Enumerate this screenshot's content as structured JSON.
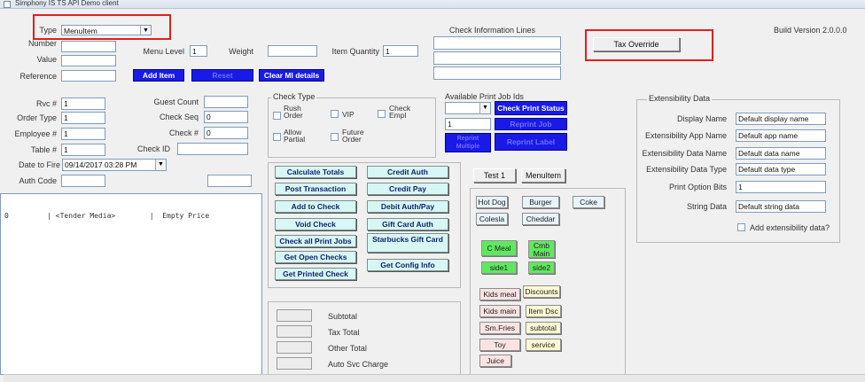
{
  "window": {
    "title": "Simphony IS TS API Demo client"
  },
  "build_version": "Build Version 2.0.0.0",
  "top": {
    "type_label": "Type",
    "type_value": "MenuItem",
    "number_label": "Number",
    "value_label": "Value",
    "reference_label": "Reference",
    "menu_level_label": "Menu Level",
    "menu_level_value": "1",
    "weight_label": "Weight",
    "item_quantity_label": "Item Quantity",
    "item_quantity_value": "1",
    "add_item": "Add Item",
    "reset": "Reset",
    "clear_mi_details": "Clear MI details",
    "check_info_lines_label": "Check Information Lines",
    "tax_override": "Tax Override"
  },
  "left": {
    "rvc_label": "Rvc #",
    "rvc_value": "1",
    "order_type_label": "Order Type",
    "order_type_value": "1",
    "employee_label": "Employee #",
    "employee_value": "1",
    "table_label": "Table #",
    "table_value": "1",
    "date_label": "Date to Fire",
    "date_value": "09/14/2017  03:28 PM",
    "auth_code_label": "Auth Code",
    "guest_count_label": "Guest Count",
    "check_seq_label": "Check Seq",
    "check_seq_value": "0",
    "check_num_label": "Check #",
    "check_num_value": "0",
    "check_id_label": "Check ID",
    "list_row": "0         | <Tender Media>        |  Empty Price"
  },
  "check_type": {
    "title": "Check Type",
    "rush_order": "Rush Order",
    "vip": "VIP",
    "check_empl": "Check Empl",
    "allow_partial": "Allow Partial",
    "future_order": "Future Order"
  },
  "print_jobs": {
    "title": "Available Print Job Ids",
    "input_value": "1",
    "check_print_status": "Check Print Status",
    "reprint_job": "Reprint Job",
    "reprint_label": "Reprint Label",
    "reprint_multiple": "Reprint Multiple"
  },
  "actions": {
    "calculate_totals": "Calculate Totals",
    "post_transaction": "Post Transaction",
    "add_to_check": "Add to Check",
    "void_check": "Void Check",
    "check_all_print_jobs": "Check all Print Jobs",
    "get_open_checks": "Get Open Checks",
    "get_printed_check": "Get Printed Check",
    "credit_auth": "Credit Auth",
    "credit_pay": "Credit Pay",
    "debit_auth_pay": "Debit Auth/Pay",
    "gift_card_auth": "Gift Card Auth",
    "starbucks_gift_card": "Starbucks Gift Card",
    "get_config_info": "Get Config Info"
  },
  "totals": {
    "subtotal": "Subtotal",
    "tax_total": "Tax Total",
    "other_total": "Other Total",
    "auto_svc_charge": "Auto Svc Charge"
  },
  "product_tabs": {
    "test1": "Test 1",
    "menuitem": "MenuItem"
  },
  "products": {
    "hot_dog": "Hot Dog",
    "burger": "Burger",
    "coke": "Coke",
    "coleslaw": "Colesla",
    "cheddar": "Cheddar",
    "c_meal": "C Meal",
    "cmb_main": "Cmb Main",
    "side1": "side1",
    "side2": "side2",
    "kids_meal": "Kids meal",
    "discounts": "Discounts",
    "kids_main": "Kids main",
    "item_disc": "Item Dsc",
    "sm_fries": "Sm.Fries",
    "subtotal": "subtotal",
    "toy": "Toy",
    "service": "service",
    "juice": "Juice"
  },
  "ext": {
    "title": "Extensibility Data",
    "display_name_label": "Display Name",
    "display_name_value": "Default display name",
    "app_name_label": "Extensibility App Name",
    "app_name_value": "Default app name",
    "data_name_label": "Extensibility Data Name",
    "data_name_value": "Default data name",
    "data_type_label": "Extensibility Data Type",
    "data_type_value": "Default data type",
    "print_option_label": "Print Option Bits",
    "print_option_value": "1",
    "string_data_label": "String Data",
    "string_data_value": "Default string data",
    "add_ext_label": "Add extensibility data?"
  },
  "colors": {
    "blue_button": "#1a1ae6",
    "cyan_button": "#d6f7f3",
    "highlight": "#e02020",
    "green_button": "#5fe85f"
  }
}
